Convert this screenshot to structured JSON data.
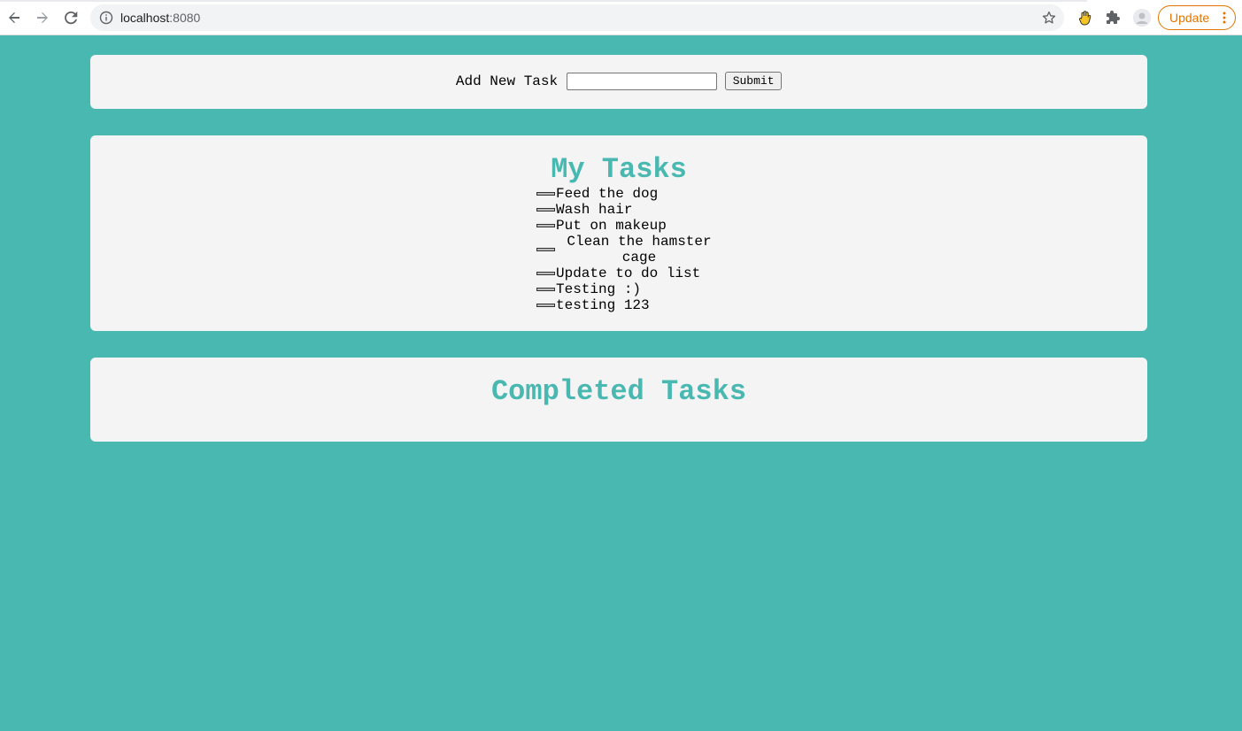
{
  "browser": {
    "url_host": "localhost",
    "url_port": ":8080",
    "update_label": "Update",
    "icons": [
      "back-icon",
      "forward-icon",
      "reload-icon",
      "site-info-icon",
      "bookmark-star-icon",
      "extension-hand-icon",
      "extensions-puzzle-icon",
      "profile-avatar-icon",
      "menu-dots-icon"
    ],
    "accent_color": "#e37400"
  },
  "add_form": {
    "label": "Add New Task",
    "input_value": "",
    "submit_label": "Submit"
  },
  "my_tasks": {
    "title": "My Tasks",
    "items": [
      {
        "label": "Feed the dog",
        "checked": false
      },
      {
        "label": "Wash hair",
        "checked": false
      },
      {
        "label": "Put on makeup",
        "checked": false
      },
      {
        "label": "Clean the hamster cage",
        "checked": false
      },
      {
        "label": "Update to do list",
        "checked": false
      },
      {
        "label": "Testing :)",
        "checked": false
      },
      {
        "label": "testing 123",
        "checked": false
      }
    ]
  },
  "completed_tasks": {
    "title": "Completed Tasks",
    "items": []
  },
  "colors": {
    "background": "#48b8b0",
    "card": "#f4f4f4",
    "title": "#48b8b0"
  }
}
